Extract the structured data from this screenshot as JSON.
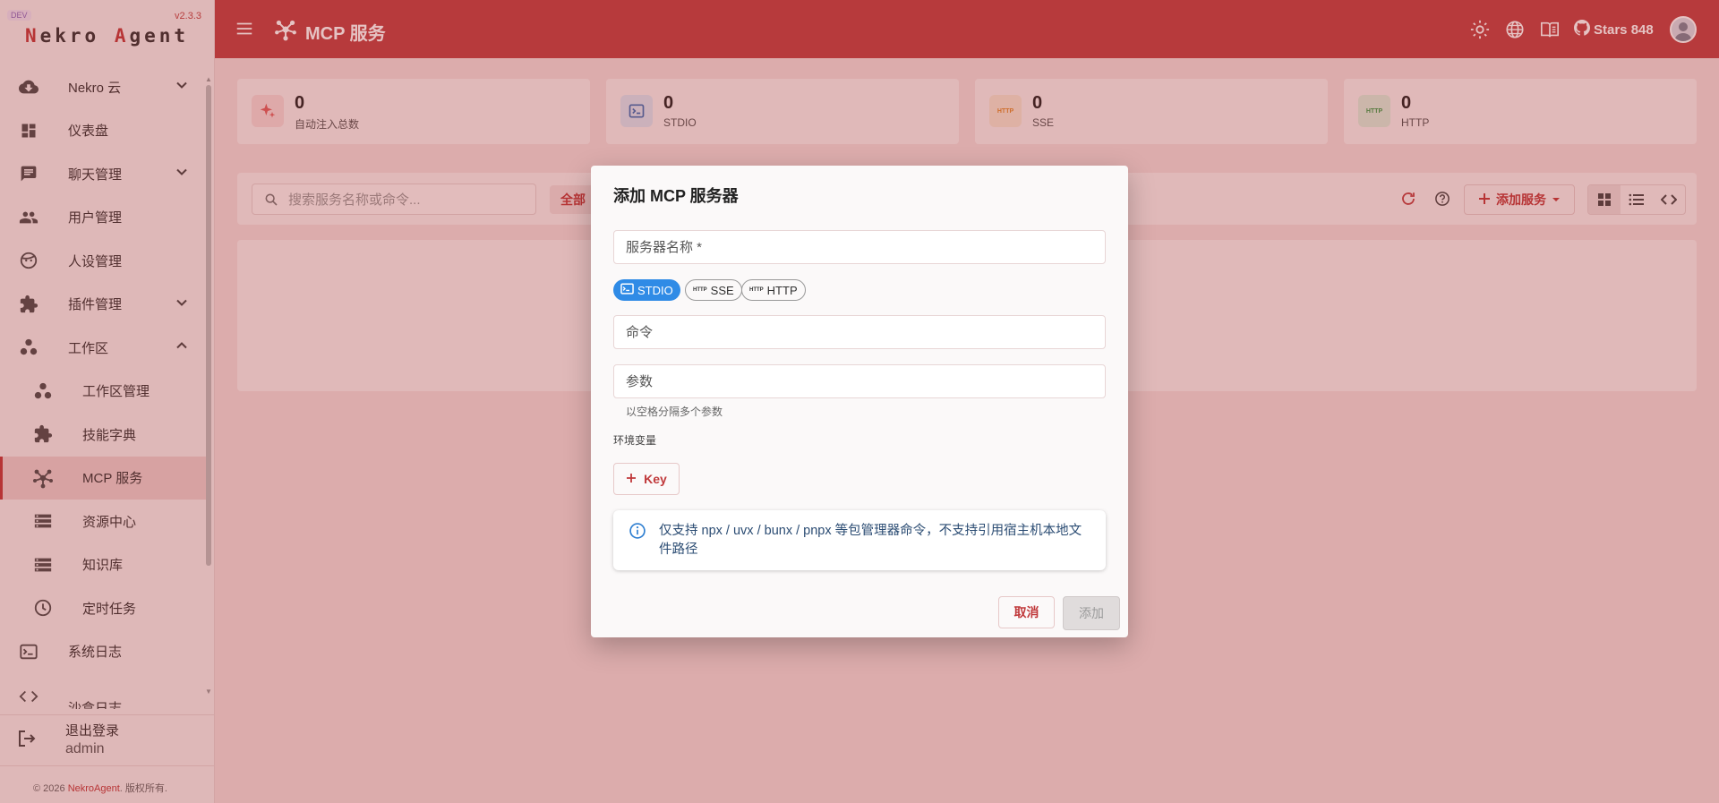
{
  "app": {
    "dev_badge": "DEV",
    "version": "v2.3.3",
    "logo_parts": [
      "N",
      "ekro ",
      "A",
      "gent"
    ]
  },
  "sidebar": {
    "items": [
      {
        "label": "Nekro 云",
        "icon": "cloud-download-icon",
        "expandable": true,
        "expanded": false
      },
      {
        "label": "仪表盘",
        "icon": "dashboard-icon"
      },
      {
        "label": "聊天管理",
        "icon": "chat-icon",
        "expandable": true,
        "expanded": false
      },
      {
        "label": "用户管理",
        "icon": "users-icon"
      },
      {
        "label": "人设管理",
        "icon": "face-icon"
      },
      {
        "label": "插件管理",
        "icon": "puzzle-icon",
        "expandable": true,
        "expanded": false
      },
      {
        "label": "工作区",
        "icon": "workspaces-icon",
        "expandable": true,
        "expanded": true
      },
      {
        "label": "工作区管理",
        "icon": "workspaces-icon",
        "sub": true
      },
      {
        "label": "技能字典",
        "icon": "puzzle-icon",
        "sub": true
      },
      {
        "label": "MCP 服务",
        "icon": "hub-icon",
        "sub": true,
        "active": true
      },
      {
        "label": "资源中心",
        "icon": "storage-icon",
        "sub": true
      },
      {
        "label": "知识库",
        "icon": "storage-icon",
        "sub": true
      },
      {
        "label": "定时任务",
        "icon": "clock-icon",
        "sub": true
      },
      {
        "label": "系统日志",
        "icon": "terminal-icon"
      },
      {
        "label": "沙盒日志",
        "icon": "code-icon"
      }
    ],
    "logout_label": "退出登录",
    "username": "admin",
    "copyright_prefix": "© 2026 ",
    "copyright_brand": "NekroAgent",
    "copyright_suffix": ". 版权所有."
  },
  "header": {
    "title": "MCP 服务",
    "github_label": "Stars 848"
  },
  "stats": [
    {
      "value": "0",
      "label": "自动注入总数",
      "icon": "sparkle-icon"
    },
    {
      "value": "0",
      "label": "STDIO",
      "icon": "terminal-icon"
    },
    {
      "value": "0",
      "label": "SSE",
      "icon": "http-icon"
    },
    {
      "value": "0",
      "label": "HTTP",
      "icon": "http-icon"
    }
  ],
  "toolbar": {
    "search_placeholder": "搜索服务名称或命令...",
    "filter_all": "全部",
    "add_service": "添加服务"
  },
  "dialog": {
    "title": "添加 MCP 服务器",
    "name_placeholder": "服务器名称 *",
    "transport_options": [
      "STDIO",
      "SSE",
      "HTTP"
    ],
    "transport_selected": "STDIO",
    "http_mini": "HTTP",
    "command_placeholder": "命令",
    "args_placeholder": "参数",
    "args_hint": "以空格分隔多个参数",
    "env_label": "环境变量",
    "key_button": "Key",
    "info_text": "仅支持 npx / uvx / bunx / pnpx 等包管理器命令，不支持引用宿主机本地文件路径",
    "cancel": "取消",
    "add": "添加"
  },
  "colors": {
    "primary": "#c0393b",
    "header_bg": "#c04244",
    "chip_active": "#2f8be6",
    "info": "#2f7fd1"
  }
}
